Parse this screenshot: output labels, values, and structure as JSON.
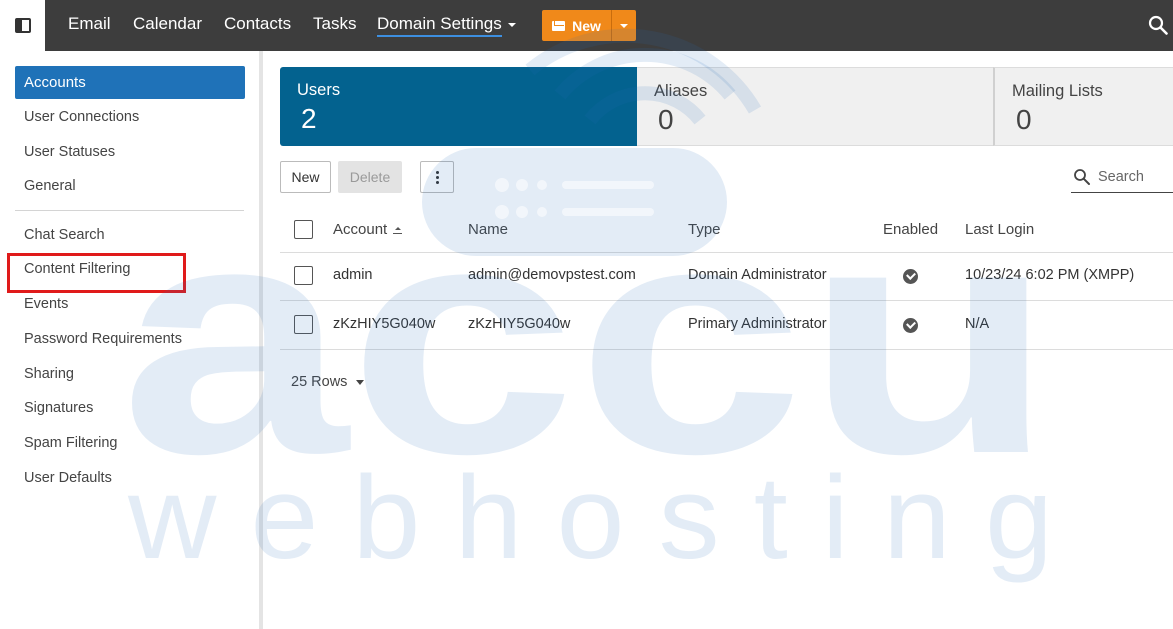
{
  "topnav": {
    "items": [
      "Email",
      "Calendar",
      "Contacts",
      "Tasks"
    ],
    "active": "Domain Settings",
    "new_button": "New"
  },
  "sidebar": {
    "active": "Accounts",
    "group1": [
      "User Connections",
      "User Statuses",
      "General"
    ],
    "group2": [
      "Chat Search",
      "Content Filtering",
      "Events",
      "Password Requirements",
      "Sharing",
      "Signatures",
      "Spam Filtering",
      "User Defaults"
    ]
  },
  "stats": [
    {
      "label": "Users",
      "value": "2"
    },
    {
      "label": "Aliases",
      "value": "0"
    },
    {
      "label": "Mailing Lists",
      "value": "0"
    }
  ],
  "toolbar": {
    "new": "New",
    "delete": "Delete",
    "search_placeholder": "Search"
  },
  "table": {
    "headers": {
      "account": "Account",
      "name": "Name",
      "type": "Type",
      "enabled": "Enabled",
      "last_login": "Last Login"
    },
    "rows": [
      {
        "account": "admin",
        "name": "admin@demovpstest.com",
        "type": "Domain Administrator",
        "last_login": "10/23/24 6:02 PM (XMPP)"
      },
      {
        "account": "zKzHIY5G040w",
        "name": "zKzHIY5G040w",
        "type": "Primary Administrator",
        "last_login": "N/A"
      }
    ]
  },
  "pager": {
    "rows_label": "25 Rows"
  },
  "watermark": {
    "brand": "accu",
    "tagline": "w e b   h o s t i n g"
  },
  "colors": {
    "accent": "#1f72b8",
    "users_card": "#03628f",
    "new_button": "#f0891a",
    "highlight": "#e01a1a"
  }
}
